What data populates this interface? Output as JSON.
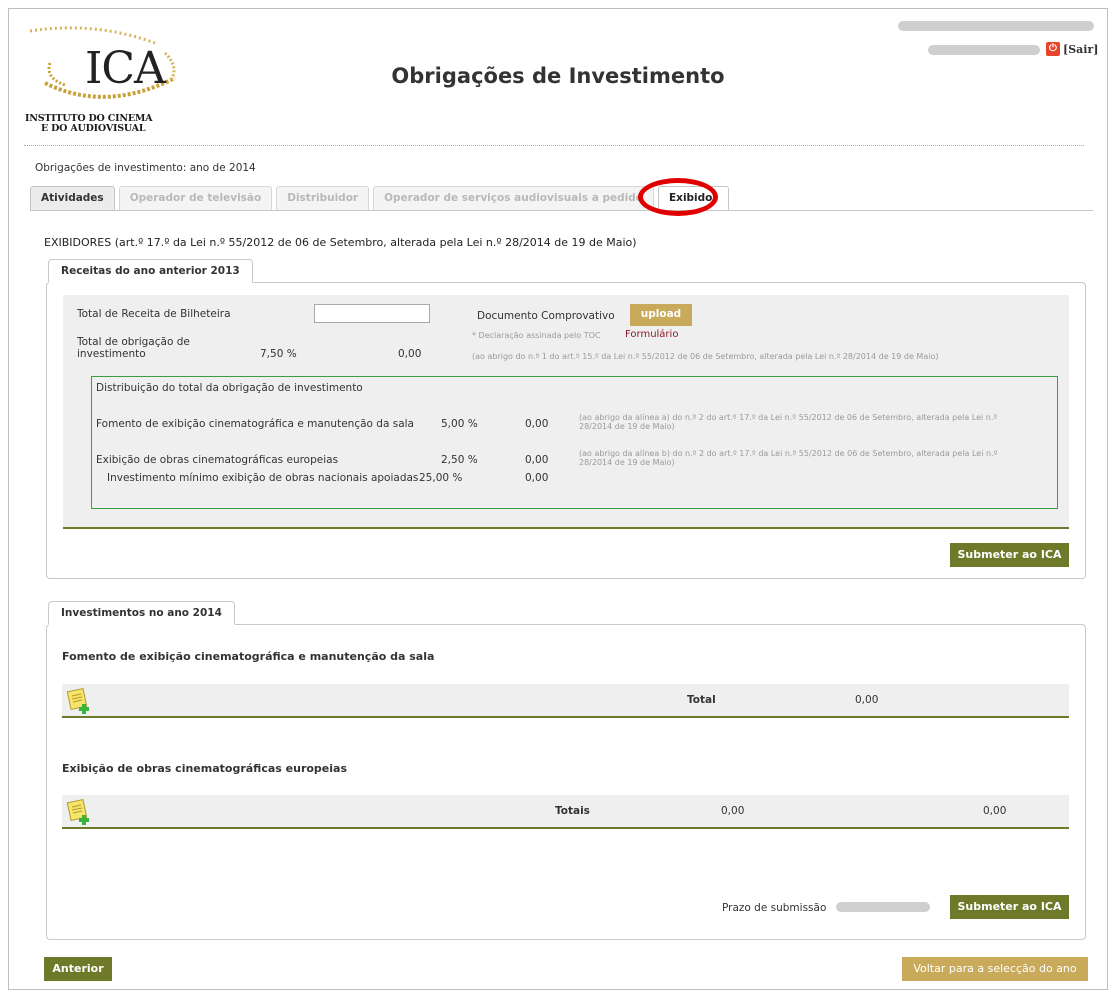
{
  "header": {
    "logo_text": "ICA",
    "logo_line1": "INSTITUTO DO CINEMA",
    "logo_line2": "E DO AUDIOVISUAL",
    "title": "Obrigações de Investimento",
    "logout_label": "[Sair]",
    "logout_icon": "power-icon"
  },
  "breadcrumb": "Obrigações de investimento: ano de 2014",
  "tabs": [
    {
      "label": "Atividades",
      "state": "active"
    },
    {
      "label": "Operador de televisão",
      "state": "disabled"
    },
    {
      "label": "Distribuidor",
      "state": "disabled"
    },
    {
      "label": "Operador de serviços audiovisuais a pedido",
      "state": "disabled"
    },
    {
      "label": "Exibidor",
      "state": "current"
    }
  ],
  "section_heading": "EXIBIDORES (art.º 17.º da Lei n.º 55/2012 de 06 de Setembro, alterada pela Lei n.º 28/2014 de 19 de Maio)",
  "receitas": {
    "tab_label": "Receitas do ano anterior 2013",
    "total_receita_label": "Total de Receita de Bilheteira",
    "total_receita_value": "",
    "documento_label": "Documento Comprovativo",
    "upload_label": "upload",
    "declaracao_note": "* Declaração assinada pelo TOC",
    "formulario_link": "Formulário",
    "total_obrigacao_label_1": "Total de obrigação de",
    "total_obrigacao_label_2": "investimento",
    "total_obrigacao_pct": "7,50 %",
    "total_obrigacao_value": "0,00",
    "total_obrigacao_note": "(ao abrigo do n.º 1 do art.º 15.º da Lei n.º 55/2012 de 06 de Setembro, alterada pela Lei n.º 28/2014 de 19 de Maio)",
    "distribuicao": {
      "title": "Distribuição do total da obrigação de investimento",
      "rows": [
        {
          "label": "Fomento de exibição cinematográfica e manutenção da sala",
          "pct": "5,00 %",
          "value": "0,00",
          "note_1": "(ao abrigo da alínea a) do n.º 2 do art.º 17.º da Lei n.º 55/2012 de 06 de Setembro, alterada pela Lei n.º",
          "note_2": "28/2014 de 19 de Maio)"
        },
        {
          "label": "Exibição de obras cinematográficas europeias",
          "pct": "2,50 %",
          "value": "0,00",
          "note_1": "(ao abrigo da alínea b) do n.º 2 do art.º 17.º da Lei n.º 55/2012 de 06 de Setembro, alterada pela Lei n.º",
          "note_2": "28/2014 de 19 de Maio)"
        },
        {
          "label": "Investimento mínimo exibição de obras nacionais apoiadas",
          "pct": "25,00 %",
          "value": "0,00"
        }
      ]
    },
    "submit_label": "Submeter ao ICA"
  },
  "investimentos": {
    "tab_label": "Investimentos no ano 2014",
    "fomento": {
      "heading": "Fomento de exibição cinematográfica e manutenção da sala",
      "total_label": "Total",
      "total_value": "0,00"
    },
    "exibicao": {
      "heading": "Exibição de obras cinematográficas europeias",
      "total_label": "Totais",
      "total_value_1": "0,00",
      "total_value_2": "0,00"
    },
    "prazo_label": "Prazo de submissão",
    "submit_label": "Submeter ao ICA"
  },
  "footer": {
    "anterior_label": "Anterior",
    "voltar_label": "Voltar para a selecção do ano"
  },
  "colors": {
    "olive": "#6e7a2a",
    "tan": "#c9a95a",
    "highlight_ring": "#e00000",
    "green_border": "#3d9e3d",
    "link": "#8b1a2a"
  }
}
